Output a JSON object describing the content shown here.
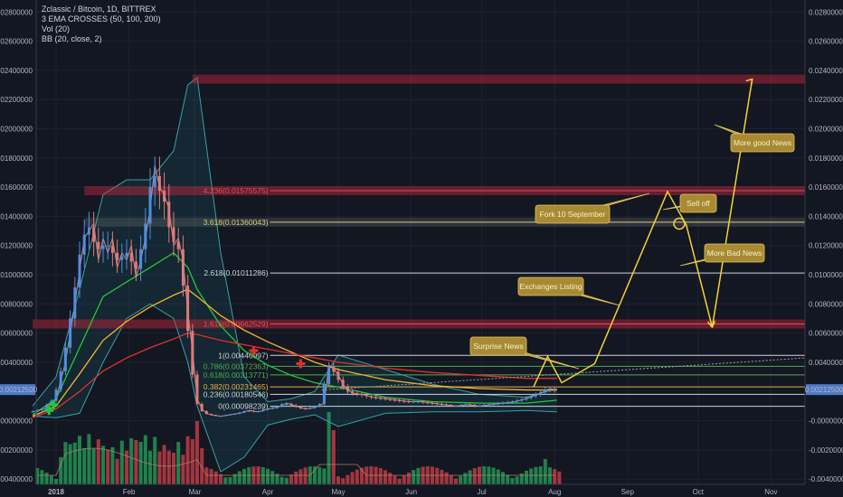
{
  "chart_data": {
    "type": "line",
    "title": "Zclassic / Bitcoin, 1D, BITTREX",
    "indicators": [
      "3 EMA CROSSES (50, 100, 200)",
      "Vol (20)",
      "BB (20, close, 2)"
    ],
    "ylim": [
      -0.004,
      0.029
    ],
    "y_ticks": [
      "0.02800000",
      "0.02600000",
      "0.02400000",
      "0.02200000",
      "0.02000000",
      "0.01800000",
      "0.01600000",
      "0.01400000",
      "0.01200000",
      "0.01000000",
      "0.00800000",
      "0.00600000",
      "0.00400000",
      "-0.00000000",
      "-0.00200000",
      "-0.00400000"
    ],
    "y_tick_values": [
      0.028,
      0.026,
      0.024,
      0.022,
      0.02,
      0.018,
      0.016,
      0.014,
      0.012,
      0.01,
      0.008,
      0.006,
      0.004,
      0.0,
      -0.002,
      -0.004
    ],
    "x_ticks": [
      "2018",
      "Feb",
      "Mar",
      "Apr",
      "May",
      "Jun",
      "Jul",
      "Aug",
      "Sep",
      "Oct",
      "Nov"
    ],
    "x_tick_days": [
      0,
      31,
      59,
      90,
      120,
      151,
      181,
      212,
      243,
      273,
      304
    ],
    "last_price_label": "0.00212500",
    "last_price": 0.002125,
    "price_days": [
      -10,
      -5,
      0,
      4,
      8,
      12,
      16,
      18,
      20,
      22,
      24,
      26,
      28,
      30,
      32,
      34,
      36,
      38,
      40,
      42,
      44,
      46,
      48,
      50,
      52,
      54,
      56,
      58,
      60,
      62,
      64,
      66,
      70,
      74,
      78,
      82,
      86,
      90,
      94,
      98,
      102,
      106,
      110,
      114,
      116,
      118,
      120,
      122,
      124,
      126,
      130,
      135,
      140,
      145,
      150,
      155,
      160,
      165,
      170,
      175,
      180,
      185,
      190,
      195,
      200,
      205,
      210,
      213
    ],
    "price_values": [
      0.0006,
      0.0008,
      0.0015,
      0.004,
      0.008,
      0.0125,
      0.0135,
      0.011,
      0.0125,
      0.0115,
      0.0125,
      0.0105,
      0.0115,
      0.011,
      0.012,
      0.0098,
      0.011,
      0.0125,
      0.0145,
      0.0175,
      0.016,
      0.0155,
      0.0145,
      0.012,
      0.0125,
      0.011,
      0.0075,
      0.0048,
      0.0015,
      0.0008,
      0.0005,
      0.0004,
      0.0003,
      0.0004,
      0.0005,
      0.0007,
      0.0006,
      0.0008,
      0.0009,
      0.0012,
      0.001,
      0.0008,
      0.0009,
      0.0012,
      0.0038,
      0.0036,
      0.0031,
      0.0025,
      0.0021,
      0.0019,
      0.0018,
      0.0016,
      0.0015,
      0.0014,
      0.0013,
      0.0013,
      0.0012,
      0.0011,
      0.001,
      0.0011,
      0.001,
      0.0011,
      0.0012,
      0.0013,
      0.0015,
      0.0018,
      0.0022,
      0.0021
    ],
    "ema_days": [
      -10,
      0,
      10,
      20,
      30,
      40,
      50,
      56,
      60,
      70,
      80,
      90,
      100,
      110,
      120,
      140,
      160,
      180,
      200,
      213
    ],
    "ema_50": [
      0.0004,
      0.0015,
      0.005,
      0.0085,
      0.0095,
      0.0105,
      0.0115,
      0.0105,
      0.009,
      0.0065,
      0.0048,
      0.0038,
      0.0031,
      0.0026,
      0.0023,
      0.0016,
      0.0013,
      0.0012,
      0.0012,
      0.0014
    ],
    "ema_100": [
      0.0003,
      0.001,
      0.0032,
      0.0055,
      0.0068,
      0.0078,
      0.0086,
      0.009,
      0.0085,
      0.0072,
      0.0062,
      0.0054,
      0.0047,
      0.004,
      0.0035,
      0.0028,
      0.0024,
      0.0022,
      0.0021,
      0.0021
    ],
    "ema_200": [
      0.0002,
      0.0008,
      0.002,
      0.0034,
      0.0043,
      0.005,
      0.0056,
      0.006,
      0.0059,
      0.0055,
      0.0052,
      0.0049,
      0.0046,
      0.0043,
      0.004,
      0.0036,
      0.0033,
      0.0031,
      0.0029,
      0.0029
    ],
    "bb_upper": [
      0.001,
      0.003,
      0.009,
      0.0155,
      0.0165,
      0.0165,
      0.0185,
      0.023,
      0.0235,
      0.0115,
      0.003,
      0.0013,
      0.0015,
      0.002,
      0.0045,
      0.0035,
      0.0025,
      0.0018,
      0.0016,
      0.0022
    ],
    "bb_lower": [
      0.0003,
      0.0002,
      0.0005,
      0.004,
      0.007,
      0.008,
      0.007,
      0.004,
      0.001,
      -0.0035,
      -0.0025,
      -0.0003,
      0.0001,
      0.0004,
      -0.0004,
      0.0005,
      0.0006,
      0.0006,
      0.0007,
      0.0006
    ],
    "fib_levels": [
      {
        "label": "4.236(0.01575575)",
        "value": 0.01575575,
        "color": "#e24d5b"
      },
      {
        "label": "3.618(0.01360043)",
        "value": 0.01360043,
        "color": "#d6cc7c"
      },
      {
        "label": "2.618(0.01011286)",
        "value": 0.01011286,
        "color": "#d1d4dc"
      },
      {
        "label": "1.618(0.00662529)",
        "value": 0.00662529,
        "color": "#e24d5b"
      },
      {
        "label": "1(0.00446997)",
        "value": 0.00446997,
        "color": "#d1d4dc"
      },
      {
        "label": "0.786(0.00372363)",
        "value": 0.00372363,
        "color": "#4caf50"
      },
      {
        "label": "0.618(0.00313771)",
        "value": 0.00313771,
        "color": "#4caf50"
      },
      {
        "label": "0.382(0.00231465)",
        "value": 0.00231465,
        "color": "#e0b34a"
      },
      {
        "label": "0.236(0.00180546)",
        "value": 0.00180546,
        "color": "#d1d4dc"
      },
      {
        "label": "0(0.00098239)",
        "value": 0.00098239,
        "color": "#d1d4dc"
      }
    ],
    "resistance_zones": [
      {
        "value": 0.0234,
        "from_day": 58
      },
      {
        "value": 0.01575575,
        "from_day": 12
      },
      {
        "value": 0.01360043,
        "from_day": 12
      },
      {
        "value": 0.00662529,
        "from_day": -10
      }
    ],
    "projection_days": [
      203,
      209,
      215,
      229,
      260,
      268,
      279,
      296
    ],
    "projection_values": [
      0.0023,
      0.0044,
      0.0026,
      0.0039,
      0.0157,
      0.0134,
      0.0064,
      0.0234
    ],
    "annotations": [
      {
        "text": "Surprise News"
      },
      {
        "text": "Exchanges Listing"
      },
      {
        "text": "Fork 10 September"
      },
      {
        "text": "Sell off"
      },
      {
        "text": "More Bad News"
      },
      {
        "text": "More good News"
      }
    ]
  }
}
